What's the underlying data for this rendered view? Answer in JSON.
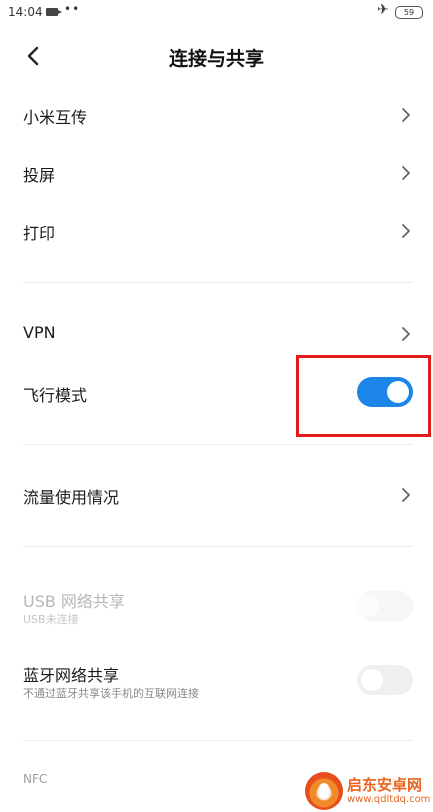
{
  "status_bar": {
    "time": "14:04",
    "dots": "••",
    "airplane_icon": "airplane-icon",
    "battery": "59"
  },
  "header": {
    "title": "连接与共享",
    "back_icon": "chevron-left-icon"
  },
  "items": [
    {
      "label": "小米互传",
      "type": "nav"
    },
    {
      "label": "投屏",
      "type": "nav"
    },
    {
      "label": "打印",
      "type": "nav"
    },
    {
      "label": "VPN",
      "type": "nav"
    },
    {
      "label": "飞行模式",
      "type": "toggle",
      "state": "on"
    },
    {
      "label": "流量使用情况",
      "type": "nav"
    },
    {
      "label": "USB 网络共享",
      "sub": "USB未连接",
      "type": "toggle",
      "state": "disabled"
    },
    {
      "label": "蓝牙网络共享",
      "sub": "不通过蓝牙共享该手机的互联网连接",
      "type": "toggle",
      "state": "off"
    }
  ],
  "section_nfc": "NFC",
  "colors": {
    "accent": "#1b86e8",
    "highlight": "#e11b1b",
    "watermark": "#e86420"
  },
  "watermark": {
    "title": "启东安卓网",
    "url": "www.qdltdq.com"
  }
}
